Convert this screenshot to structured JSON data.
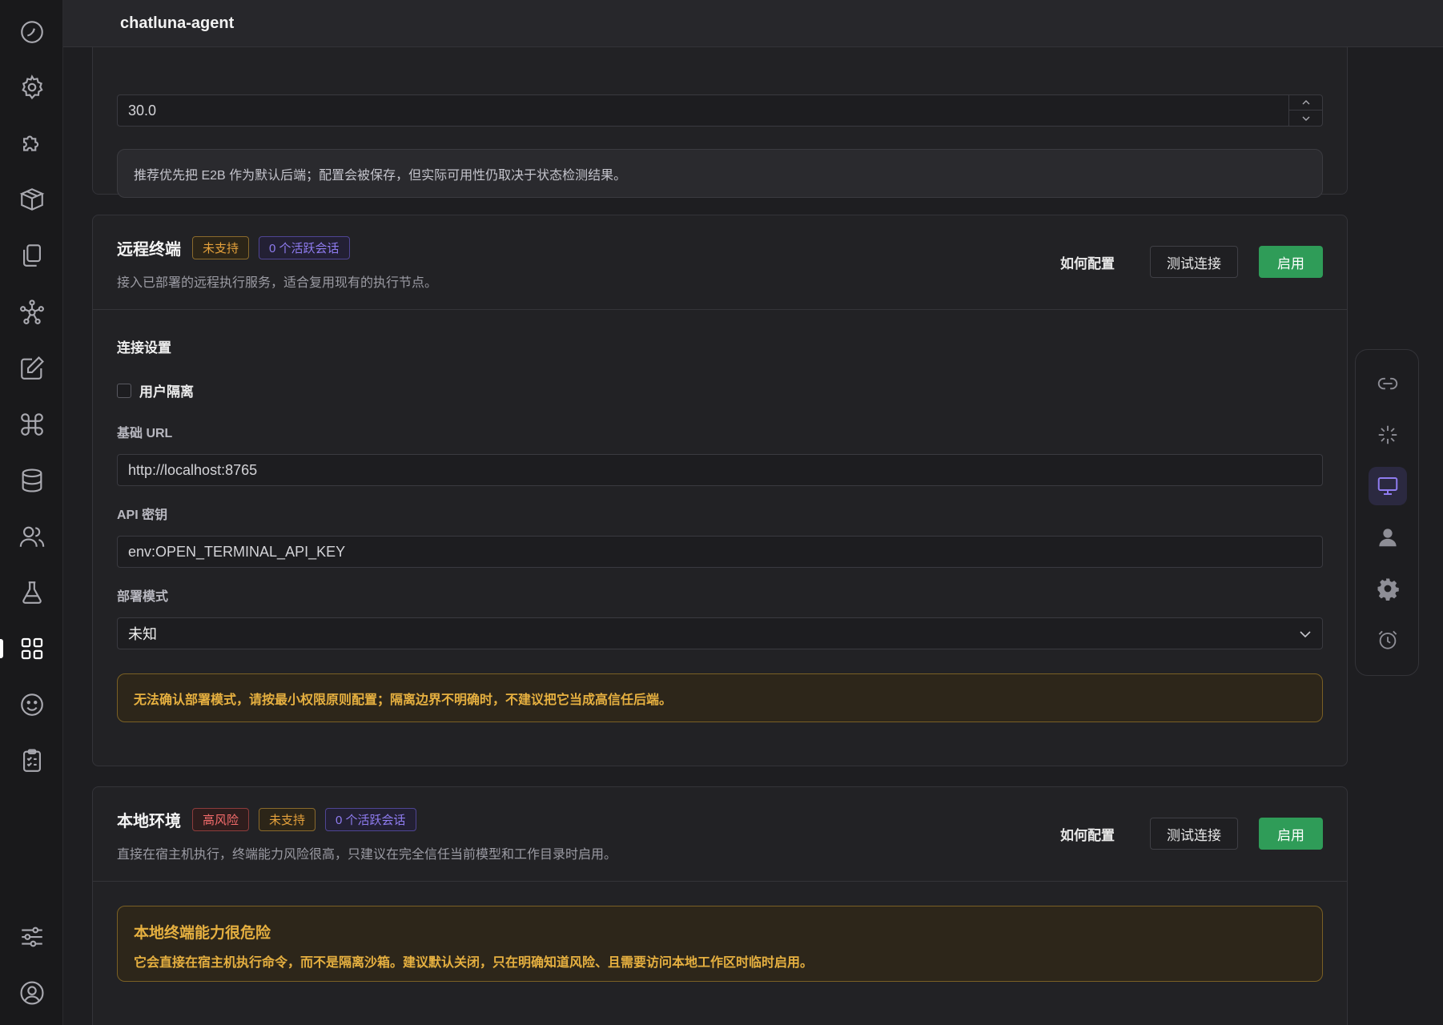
{
  "header": {
    "title": "chatluna-agent"
  },
  "nav": {
    "items": [
      {
        "icon": "dashboard-icon"
      },
      {
        "icon": "gear-icon"
      },
      {
        "icon": "puzzle-icon"
      },
      {
        "icon": "box-icon"
      },
      {
        "icon": "files-icon"
      },
      {
        "icon": "network-icon"
      },
      {
        "icon": "edit-icon"
      },
      {
        "icon": "command-icon"
      },
      {
        "icon": "database-icon"
      },
      {
        "icon": "users-icon"
      },
      {
        "icon": "flask-icon"
      },
      {
        "icon": "apps-icon",
        "active": true
      },
      {
        "icon": "smiley-icon"
      },
      {
        "icon": "clipboard-icon"
      },
      {
        "icon": "sliders-icon"
      },
      {
        "icon": "account-icon"
      }
    ]
  },
  "top_section": {
    "timeout_value": "30.0",
    "notice": "推荐优先把 E2B 作为默认后端；配置会被保存，但实际可用性仍取决于状态检测结果。"
  },
  "remote": {
    "title": "远程终端",
    "tags": {
      "unsupported": "未支持",
      "sessions": "0 个活跃会话"
    },
    "description": "接入已部署的远程执行服务，适合复用现有的执行节点。",
    "actions": {
      "howto": "如何配置",
      "test": "测试连接",
      "enable": "启用"
    },
    "section_title": "连接设置",
    "isolation_label": "用户隔离",
    "base_url_label": "基础 URL",
    "base_url_value": "http://localhost:8765",
    "api_key_label": "API 密钥",
    "api_key_value": "env:OPEN_TERMINAL_API_KEY",
    "deploy_mode_label": "部署模式",
    "deploy_mode_value": "未知",
    "warning": "无法确认部署模式，请按最小权限原则配置；隔离边界不明确时，不建议把它当成高信任后端。"
  },
  "local": {
    "title": "本地环境",
    "tags": {
      "risk": "高风险",
      "unsupported": "未支持",
      "sessions": "0 个活跃会话"
    },
    "description": "直接在宿主机执行，终端能力风险很高，只建议在完全信任当前模型和工作目录时启用。",
    "actions": {
      "howto": "如何配置",
      "test": "测试连接",
      "enable": "启用"
    },
    "danger_title": "本地终端能力很危险",
    "danger_body": "它会直接在宿主机执行命令，而不是隔离沙箱。建议默认关闭，只在明确知道风险、且需要访问本地工作区时临时启用。"
  },
  "right_panel": {
    "items": [
      {
        "icon": "link-icon"
      },
      {
        "icon": "sparkle-icon"
      },
      {
        "icon": "monitor-icon",
        "active": true
      },
      {
        "icon": "person-icon"
      },
      {
        "icon": "cog-icon"
      },
      {
        "icon": "alarm-icon"
      }
    ]
  },
  "colors": {
    "accent": "#8f7cf0",
    "primary": "#2f9c58",
    "warning": "#e6a23c",
    "danger": "#f56c6c"
  }
}
